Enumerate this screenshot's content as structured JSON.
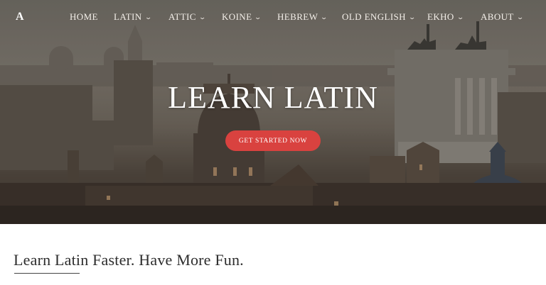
{
  "brand": {
    "logo": "A"
  },
  "nav": {
    "items": [
      {
        "label": "HOME",
        "dropdown": false
      },
      {
        "label": "LATIN",
        "dropdown": true
      },
      {
        "label": "ATTIC",
        "dropdown": true
      },
      {
        "label": "KOINE",
        "dropdown": true
      },
      {
        "label": "HEBREW",
        "dropdown": true
      },
      {
        "label": "OLD ENGLISH",
        "dropdown": true
      },
      {
        "label": "EKHO",
        "dropdown": true
      },
      {
        "label": "ABOUT",
        "dropdown": true
      }
    ],
    "chevron": "⌄"
  },
  "hero": {
    "title": "LEARN LATIN",
    "cta_label": "GET STARTED NOW",
    "cta_color": "#d9423f"
  },
  "content": {
    "heading": "Learn Latin Faster. Have More Fun."
  }
}
